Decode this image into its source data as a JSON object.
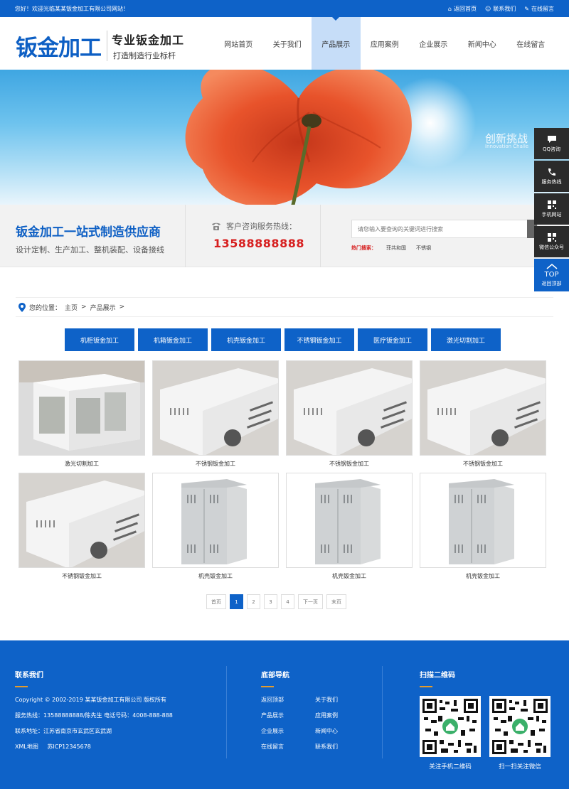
{
  "topbar": {
    "welcome": "您好！欢迎光临某某钣金加工有限公司网站！",
    "links": [
      "返回首页",
      "联系我们",
      "在线留言"
    ]
  },
  "logo": {
    "brand": "钣金加工",
    "slogan1": "专业钣金加工",
    "slogan2": "打造制造行业标杆"
  },
  "nav": {
    "items": [
      "网站首页",
      "关于我们",
      "产品展示",
      "应用案例",
      "企业展示",
      "新闻中心",
      "在线留言"
    ],
    "active_index": 2
  },
  "banner": {
    "tagline": "创新挑战",
    "tagline_en": "Innovation Challe"
  },
  "infobar": {
    "title": "钣金加工一站式制造供应商",
    "subtitle": "设计定制、生产加工、整机装配、设备接线",
    "hotline_label": "客户咨询服务热线：",
    "hotline": "13588888888",
    "search_placeholder": "请您输入要查询的关键词进行搜索",
    "hot_label": "热门搜索：",
    "hot_words": [
      "菲共和国",
      "不锈钢"
    ]
  },
  "breadcrumb": {
    "label": "您的位置：",
    "home": "主页",
    "sep": ">",
    "current": "产品展示"
  },
  "categories": [
    "机柜钣金加工",
    "机箱钣金加工",
    "机壳钣金加工",
    "不锈钢钣金加工",
    "医疗钣金加工",
    "激光切割加工"
  ],
  "products": [
    {
      "title": "激光切割加工",
      "kind": "frame"
    },
    {
      "title": "不锈钢钣金加工",
      "kind": "box"
    },
    {
      "title": "不锈钢钣金加工",
      "kind": "box"
    },
    {
      "title": "不锈钢钣金加工",
      "kind": "box"
    },
    {
      "title": "不锈钢钣金加工",
      "kind": "box"
    },
    {
      "title": "机壳钣金加工",
      "kind": "cabinet"
    },
    {
      "title": "机壳钣金加工",
      "kind": "cabinet"
    },
    {
      "title": "机壳钣金加工",
      "kind": "cabinet"
    }
  ],
  "pager": {
    "first": "首页",
    "pages": [
      "1",
      "2",
      "3",
      "4"
    ],
    "current": "1",
    "next": "下一页",
    "last": "末页"
  },
  "footer": {
    "contact_title": "联系我们",
    "copyright": "Copyright © 2002-2019 某某钣金加工有限公司 版权所有",
    "hotline": "服务热线：13588888888/陈先生    电话号码：4008-888-888",
    "address": "联系地址：江苏省南京市玄武区玄武湖",
    "sitemap": "XML地图",
    "icp": "苏ICP12345678",
    "nav_title": "底部导航",
    "nav_links": [
      "返回顶部",
      "关于我们",
      "产品展示",
      "应用案例",
      "企业展示",
      "新闻中心",
      "在线留言",
      "联系我们"
    ],
    "qr_title": "扫描二维码",
    "qr_captions": [
      "关注手机二维码",
      "扫一扫关注微信"
    ]
  },
  "sidebar": {
    "items": [
      {
        "label": "QQ咨询",
        "icon": "chat-icon"
      },
      {
        "label": "服务热线",
        "icon": "phone-icon"
      },
      {
        "label": "手机网站",
        "icon": "qr-icon"
      },
      {
        "label": "微信公众号",
        "icon": "qr-icon"
      }
    ],
    "top_big": "TOP",
    "top_label": "返回顶部"
  },
  "colors": {
    "primary": "#0e62c8",
    "hotline_red": "#d71f1f",
    "accent_orange": "#e49b2c"
  }
}
